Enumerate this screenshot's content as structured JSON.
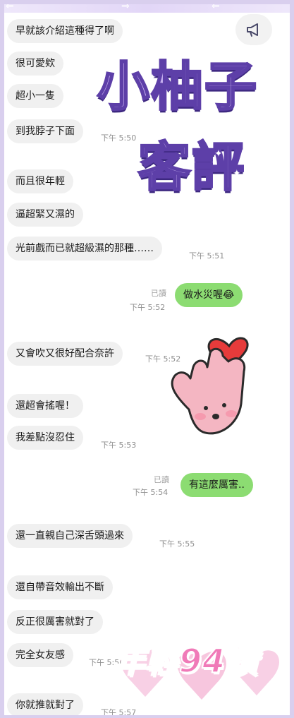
{
  "messages": [
    {
      "text": "早就該介紹這種得了啊"
    },
    {
      "text": "很可愛欸"
    },
    {
      "text": "超小一隻"
    },
    {
      "text": "到我脖子下面",
      "time": "下午 5:50"
    },
    {
      "text": "而且很年輕"
    },
    {
      "text": "逼超緊又濕的"
    },
    {
      "text": "光前戲而已就超級濕的那種……",
      "time": "下午 5:51"
    },
    {
      "text": "做水災喔",
      "emoji": "😂",
      "read": "已讀",
      "time": "下午 5:52",
      "outgoing": true
    },
    {
      "text": "又會吹又很好配合奈許",
      "time": "下午 5:52"
    },
    {
      "text": "還超會搖喔！"
    },
    {
      "text": "我差點沒忍住",
      "time": "下午 5:53"
    },
    {
      "text": "有這麼厲害..",
      "read": "已讀",
      "time": "下午 5:54",
      "outgoing": true
    },
    {
      "text": "還一直親自己深舌頭過來",
      "time": "下午 5:55"
    },
    {
      "text": "還自帶音效輸出不斷"
    },
    {
      "text": "反正很厲害就對了"
    },
    {
      "text": "完全女友感",
      "time": "下午 5:56"
    },
    {
      "text": "你就推就對了",
      "time": "下午 5:57"
    }
  ],
  "stickers": {
    "title_line_1": "小柚子",
    "title_line_2": "客評",
    "bottom_text": "年輕94讚"
  },
  "icons": {
    "announcement": "megaphone-icon",
    "heart": "heart-icon",
    "hand": "finger-heart-hand-icon"
  },
  "colors": {
    "incoming_bubble": "#f0f0f0",
    "outgoing_bubble": "#8cdc72",
    "frame": "#d9cfee",
    "title_fill": "#c7b0f0",
    "title_stroke": "#5d3fa8"
  }
}
